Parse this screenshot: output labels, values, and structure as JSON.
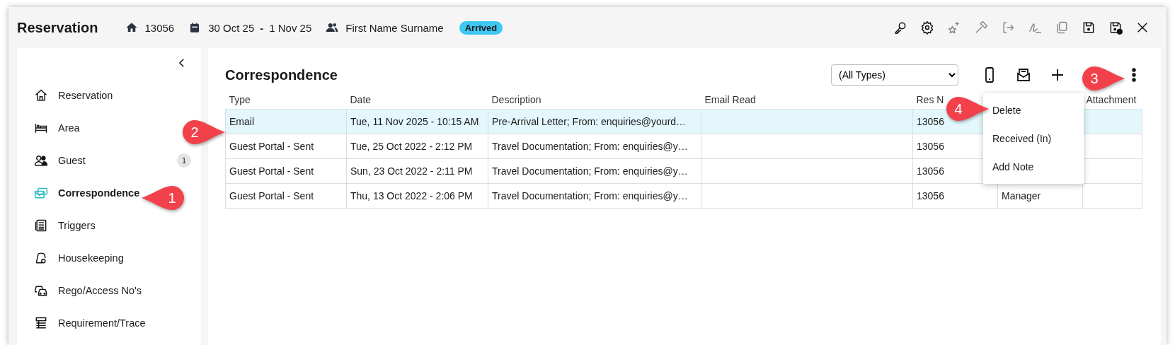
{
  "window": {
    "title": "Reservation"
  },
  "header": {
    "reservation_number": "13056",
    "date_from": "30 Oct 25",
    "date_separator": "-",
    "date_to": "1 Nov 25",
    "guest_name": "First Name Surname",
    "status": "Arrived"
  },
  "toolbar": [
    {
      "kind": "key",
      "disabled": false
    },
    {
      "kind": "gear",
      "disabled": false
    },
    {
      "kind": "sparkle",
      "disabled": true
    },
    {
      "kind": "hammer",
      "disabled": true
    },
    {
      "kind": "exit",
      "disabled": true
    },
    {
      "kind": "signature",
      "disabled": true
    },
    {
      "kind": "copy",
      "disabled": true
    },
    {
      "kind": "save",
      "disabled": false
    },
    {
      "kind": "save-close",
      "disabled": false
    },
    {
      "kind": "close",
      "disabled": false
    }
  ],
  "sidebar": {
    "items": [
      {
        "kind": "home",
        "label": "Reservation",
        "selected": false
      },
      {
        "kind": "bed",
        "label": "Area",
        "selected": false
      },
      {
        "kind": "guest",
        "label": "Guest",
        "count": "1",
        "selected": false
      },
      {
        "kind": "mail",
        "label": "Correspondence",
        "selected": true
      },
      {
        "kind": "calculator",
        "label": "Triggers",
        "selected": false
      },
      {
        "kind": "housekeeping",
        "label": "Housekeeping",
        "selected": false
      },
      {
        "kind": "cars",
        "label": "Rego/Access No's",
        "selected": false
      },
      {
        "kind": "checklist",
        "label": "Requirement/Trace",
        "selected": false
      }
    ]
  },
  "panel": {
    "title": "Correspondence",
    "filter": {
      "value": "(All Types)"
    },
    "actions": [
      {
        "kind": "phone"
      },
      {
        "kind": "envelope"
      },
      {
        "kind": "plus"
      },
      {
        "kind": "more"
      }
    ]
  },
  "table": {
    "columns": [
      "Type",
      "Date",
      "Description",
      "Email Read",
      "Res N",
      null,
      "Attachment"
    ],
    "rows": [
      {
        "selected": true,
        "cells": [
          "Email",
          "Tue, 11 Nov 2025 - 10:15 AM",
          "Pre-Arrival Letter; From: enquiries@yourd…",
          null,
          "13056",
          null,
          null
        ]
      },
      {
        "selected": false,
        "cells": [
          "Guest Portal - Sent",
          "Tue, 25 Oct 2022 - 2:12 PM",
          "Travel Documentation; From: enquiries@y…",
          null,
          "13056",
          null,
          null
        ]
      },
      {
        "selected": false,
        "cells": [
          "Guest Portal - Sent",
          "Sun, 23 Oct 2022 - 2:11 PM",
          "Travel Documentation; From: enquiries@y…",
          null,
          "13056",
          null,
          null
        ]
      },
      {
        "selected": false,
        "cells": [
          "Guest Portal - Sent",
          "Thu, 13 Oct 2022 - 2:06 PM",
          "Travel Documentation; From: enquiries@y…",
          null,
          "13056",
          "Manager",
          null
        ]
      }
    ]
  },
  "menu": {
    "items": [
      "Delete",
      "Received (In)",
      "Add Note"
    ]
  },
  "callouts": [
    {
      "number": "1",
      "kind": "left"
    },
    {
      "number": "2",
      "kind": "right"
    },
    {
      "number": "3",
      "kind": "right"
    },
    {
      "number": "4",
      "kind": "right"
    }
  ]
}
